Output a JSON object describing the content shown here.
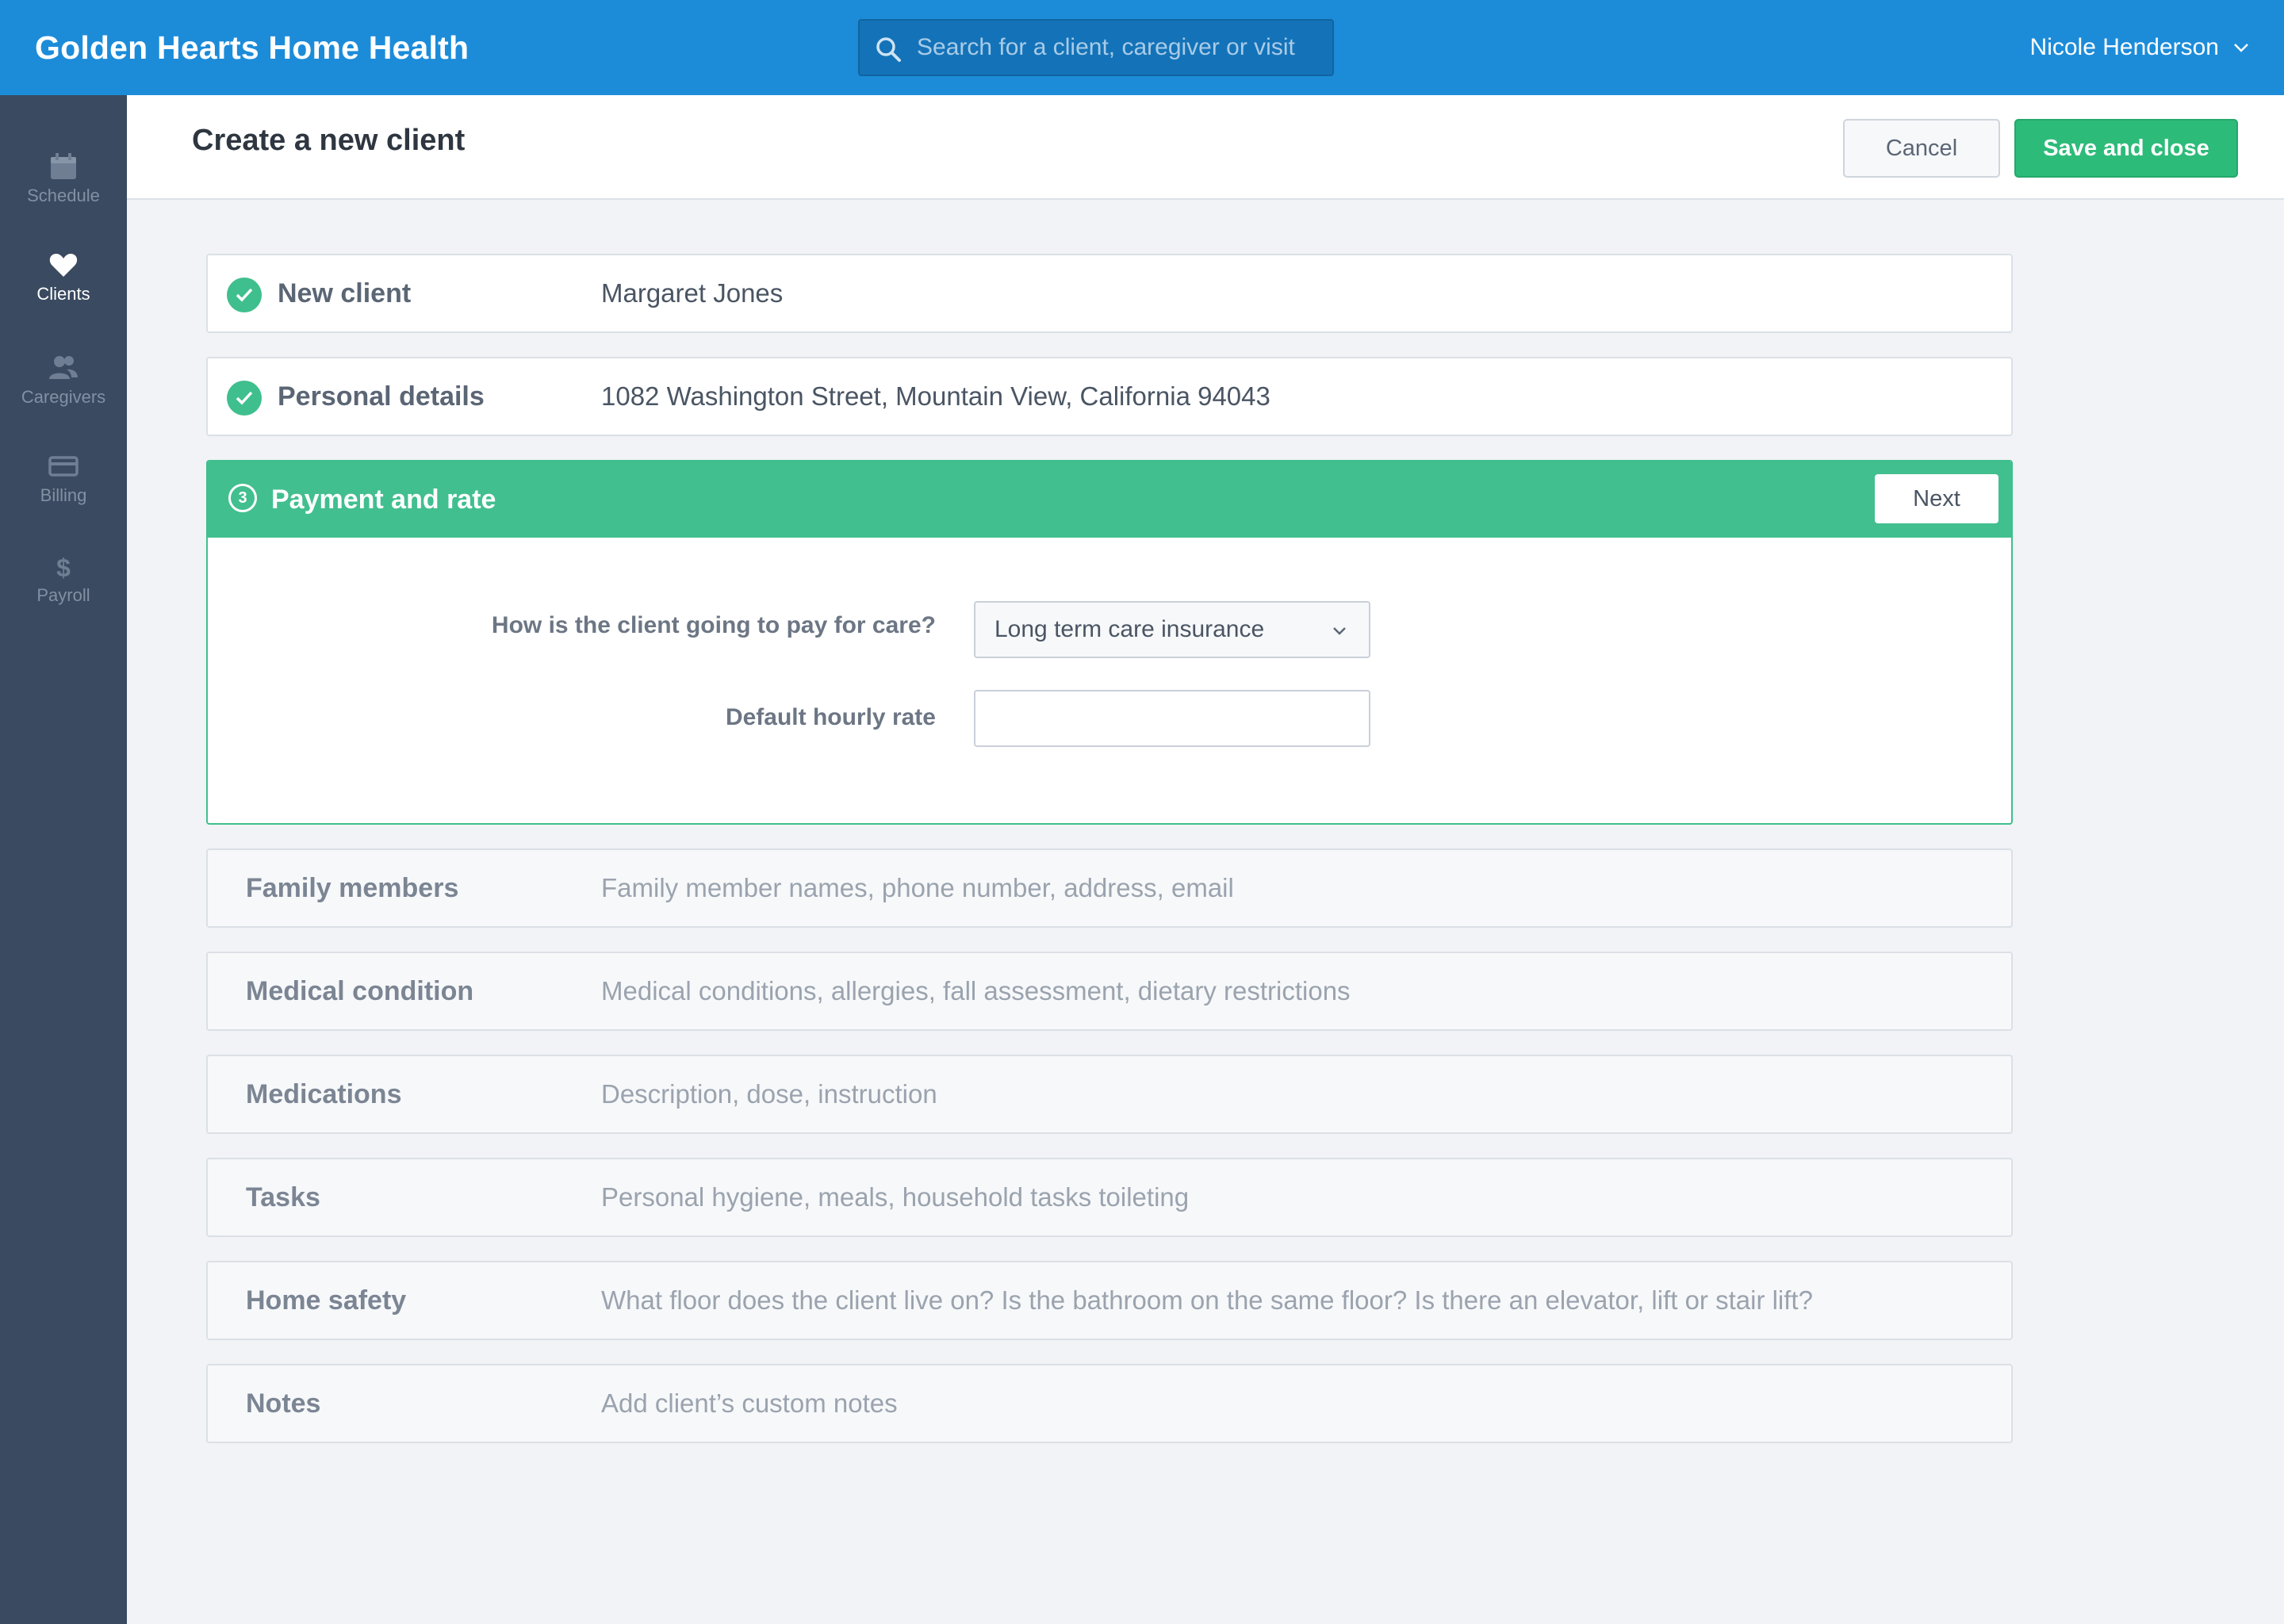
{
  "app": {
    "brand": "Golden Hearts Home Health",
    "search_placeholder": "Search for a client, caregiver or visit",
    "user_name": "Nicole Henderson"
  },
  "sidebar": {
    "items": [
      {
        "label": "Schedule",
        "icon": "calendar-icon",
        "active": false
      },
      {
        "label": "Clients",
        "icon": "heart-icon",
        "active": true
      },
      {
        "label": "Caregivers",
        "icon": "users-icon",
        "active": false
      },
      {
        "label": "Billing",
        "icon": "credit-card-icon",
        "active": false
      },
      {
        "label": "Payroll",
        "icon": "dollar-icon",
        "active": false
      }
    ]
  },
  "header": {
    "title": "Create a new client",
    "cancel_label": "Cancel",
    "save_label": "Save and close"
  },
  "completed_sections": [
    {
      "title": "New client",
      "value": "Margaret Jones"
    },
    {
      "title": "Personal details",
      "value": "1082 Washington Street, Mountain View, California 94043"
    }
  ],
  "active_section": {
    "step": "3",
    "title": "Payment and rate",
    "next_label": "Next",
    "payment_question": "How is the client going to pay for care?",
    "payment_value": "Long term care insurance",
    "rate_label": "Default hourly rate",
    "rate_value": ""
  },
  "pending_sections": [
    {
      "title": "Family members",
      "hint": "Family member names, phone number, address, email"
    },
    {
      "title": "Medical condition",
      "hint": "Medical conditions, allergies, fall assessment, dietary restrictions"
    },
    {
      "title": "Medications",
      "hint": "Description, dose, instruction"
    },
    {
      "title": "Tasks",
      "hint": "Personal hygiene, meals, household tasks toileting"
    },
    {
      "title": "Home safety",
      "hint": "What floor does the client live on? Is the bathroom on the same floor? Is there an elevator, lift or stair lift?"
    },
    {
      "title": "Notes",
      "hint": "Add client’s custom notes"
    }
  ],
  "colors": {
    "topbar": "#1c8cd9",
    "sidebar": "#3a4a60",
    "accent_green": "#41bf8f",
    "save_button": "#2dbb7a"
  }
}
